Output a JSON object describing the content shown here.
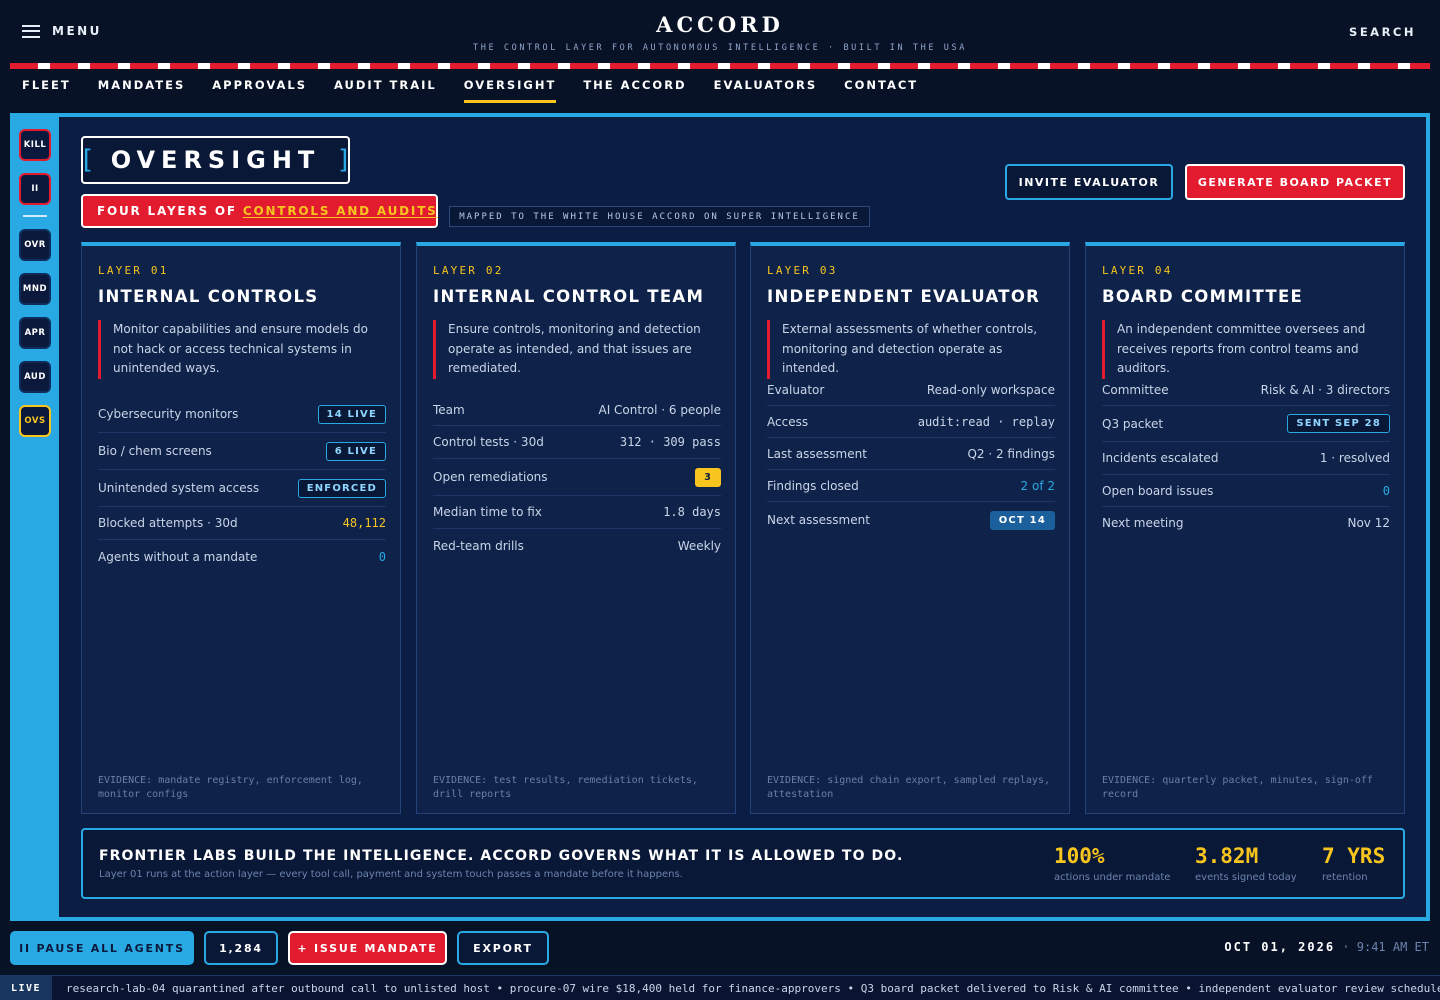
{
  "header": {
    "menu_label": "MENU",
    "brand_title": "ACCORD",
    "brand_tagline": "THE CONTROL LAYER FOR AUTONOMOUS INTELLIGENCE · BUILT IN THE USA",
    "search_label": "SEARCH"
  },
  "nav": {
    "items": [
      {
        "label": "FLEET",
        "active": false
      },
      {
        "label": "MANDATES",
        "active": false
      },
      {
        "label": "APPROVALS",
        "active": false
      },
      {
        "label": "AUDIT TRAIL",
        "active": false
      },
      {
        "label": "OVERSIGHT",
        "active": true
      },
      {
        "label": "THE ACCORD",
        "active": false
      },
      {
        "label": "EVALUATORS",
        "active": false
      },
      {
        "label": "CONTACT",
        "active": false
      }
    ]
  },
  "rail": {
    "kill": "KILL",
    "pause": "II",
    "items": [
      "OVR",
      "MND",
      "APR",
      "AUD",
      "OVS"
    ]
  },
  "page": {
    "title": "OVERSIGHT",
    "bracket_open": "[",
    "bracket_close": "]",
    "subtitle_prefix": "FOUR LAYERS OF",
    "subtitle_highlight": "CONTROLS AND AUDITS",
    "mapped_tag": "MAPPED TO THE WHITE HOUSE ACCORD ON SUPER INTELLIGENCE",
    "invite_label": "INVITE EVALUATOR",
    "packet_label": "GENERATE BOARD PACKET"
  },
  "cards": [
    {
      "layer": "LAYER 01",
      "title": "INTERNAL CONTROLS",
      "desc": "Monitor capabilities and ensure models do not hack or access technical systems in unintended ways.",
      "rows": [
        {
          "label": "Cybersecurity monitors",
          "value": "14 LIVE"
        },
        {
          "label": "Bio / chem screens",
          "value": "6 LIVE"
        },
        {
          "label": "Unintended system access",
          "value": "ENFORCED"
        },
        {
          "label": "Blocked attempts · 30d",
          "value": "48,112"
        },
        {
          "label": "Agents without a mandate",
          "value": "0"
        }
      ],
      "evidence": "EVIDENCE: mandate registry, enforcement log, monitor configs"
    },
    {
      "layer": "LAYER 02",
      "title": "INTERNAL CONTROL TEAM",
      "desc": "Ensure controls, monitoring and detection operate as intended, and that issues are remediated.",
      "rows": [
        {
          "label": "Team",
          "value": "AI Control · 6 people"
        },
        {
          "label": "Control tests · 30d",
          "value": "312 · 309 pass"
        },
        {
          "label": "Open remediations",
          "value": "3"
        },
        {
          "label": "Median time to fix",
          "value": "1.8 days"
        },
        {
          "label": "Red-team drills",
          "value": "Weekly"
        }
      ],
      "evidence": "EVIDENCE: test results, remediation tickets, drill reports"
    },
    {
      "layer": "LAYER 03",
      "title": "INDEPENDENT EVALUATOR",
      "desc": "External assessments of whether controls, monitoring and detection operate as intended.",
      "rows": [
        {
          "label": "Evaluator",
          "value": "Read-only workspace"
        },
        {
          "label": "Access",
          "value": "audit:read · replay"
        },
        {
          "label": "Last assessment",
          "value": "Q2 · 2 findings"
        },
        {
          "label": "Findings closed",
          "value": "2 of 2"
        },
        {
          "label": "Next assessment",
          "value": "OCT 14"
        }
      ],
      "evidence": "EVIDENCE: signed chain export, sampled replays, attestation"
    },
    {
      "layer": "LAYER 04",
      "title": "BOARD COMMITTEE",
      "desc": "An independent committee oversees and receives reports from control teams and auditors.",
      "rows": [
        {
          "label": "Committee",
          "value": "Risk & AI · 3 directors"
        },
        {
          "label": "Q3 packet",
          "value": "SENT SEP 28"
        },
        {
          "label": "Incidents escalated",
          "value": "1 · resolved"
        },
        {
          "label": "Open board issues",
          "value": "0"
        },
        {
          "label": "Next meeting",
          "value": "Nov 12"
        }
      ],
      "evidence": "EVIDENCE: quarterly packet, minutes, sign-off record"
    }
  ],
  "banner": {
    "headline": "FRONTIER LABS BUILD THE INTELLIGENCE. ACCORD GOVERNS WHAT IT IS ALLOWED TO DO.",
    "sub": "Layer 01 runs at the action layer — every tool call, payment and system touch passes a mandate before it happens.",
    "stats": [
      {
        "value": "100%",
        "label": "actions under mandate"
      },
      {
        "value": "3.82M",
        "label": "events signed today"
      },
      {
        "value": "7 YRS",
        "label": "retention"
      }
    ]
  },
  "bottom": {
    "pause_label": "II PAUSE ALL AGENTS",
    "count_label": "1,284",
    "issue_label": "+ ISSUE MANDATE",
    "export_label": "EXPORT",
    "date": "OCT 01, 2026",
    "time": " · 9:41 AM ET"
  },
  "ticker": {
    "live_label": "LIVE",
    "text": "research-lab-04 quarantined after outbound call to unlisted host • procure-07 wire $18,400 held for finance-approvers • Q3 board packet delivered to Risk & AI committee • independent evaluator review scheduled"
  },
  "colors": {
    "background": "#081226",
    "panel": "#0c1d44",
    "accent_blue": "#29a9e3",
    "accent_red": "#e31b2e",
    "accent_yellow": "#f7c51e"
  },
  "icons": {
    "menu": "hamburger-icon"
  }
}
